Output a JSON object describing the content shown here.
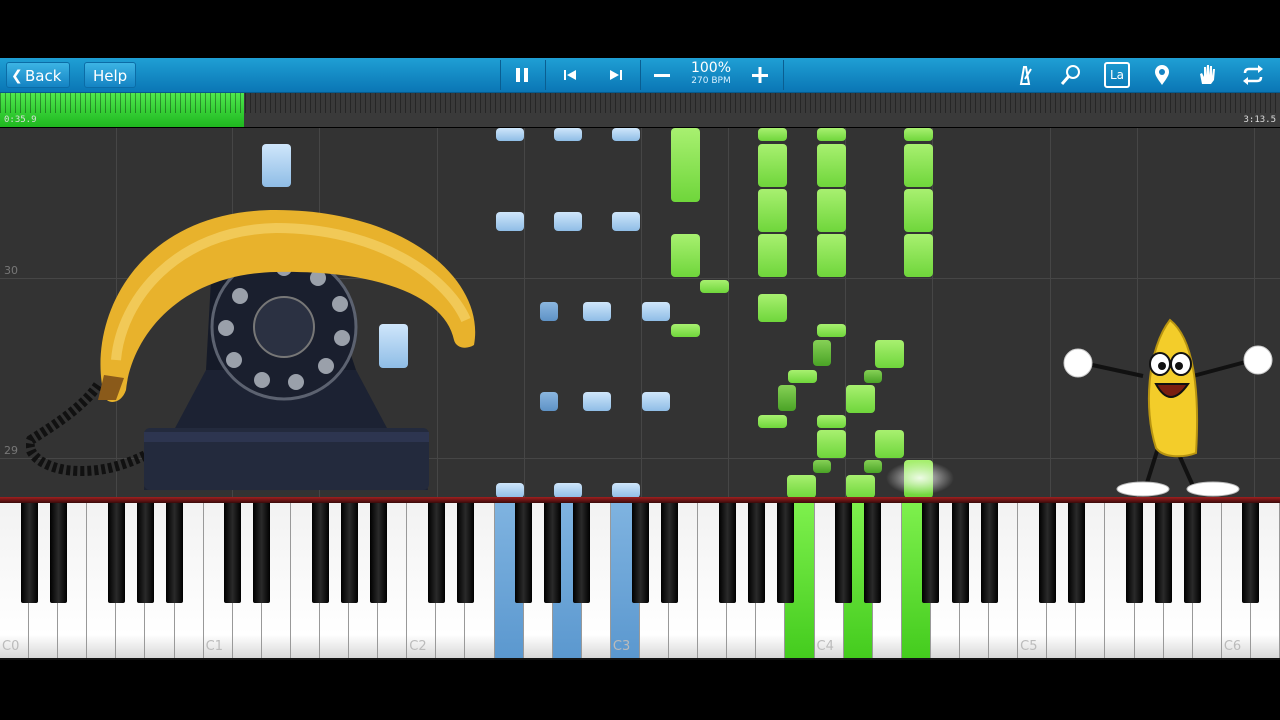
{
  "toolbar": {
    "back_label": "Back",
    "help_label": "Help",
    "tempo_percent": "100%",
    "tempo_bpm": "270 BPM",
    "icons": [
      "pause-icon",
      "skip-back-icon",
      "skip-forward-icon",
      "minus-icon",
      "plus-icon",
      "metronome-icon",
      "search-icon",
      "label-icon",
      "location-pin-icon",
      "hand-icon",
      "loop-icon"
    ],
    "label_icon_text": "La"
  },
  "progress": {
    "current_time": "0:35.9",
    "total_time": "3:13.5",
    "fraction": 0.191
  },
  "roll": {
    "measure_labels": [
      "30",
      "29"
    ]
  },
  "keyboard": {
    "octave_labels": [
      "C0",
      "C1",
      "C2",
      "C3",
      "C4",
      "C5",
      "C6"
    ],
    "highlight_colors": {
      "left_hand": "#5b98cf",
      "right_hand": "#44cc1e"
    }
  }
}
